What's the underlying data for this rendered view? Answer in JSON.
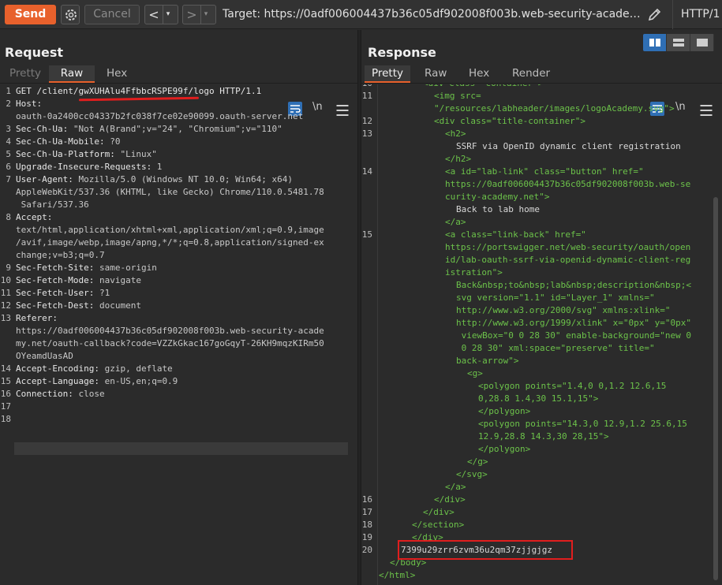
{
  "toolbar": {
    "send_label": "Send",
    "cancel_label": "Cancel",
    "back_arrow": "<",
    "forward_arrow": ">",
    "dropdown_arrow": "▾",
    "target_text": "Target: https://0adf006004437b36c05df902008f003b.web-security-academy.n...",
    "http_version": "HTTP/1",
    "send_color": "#e8612c"
  },
  "request": {
    "title": "Request",
    "tabs": [
      "Pretty",
      "Raw",
      "Hex"
    ],
    "active_tab": "Raw",
    "newline_toggle": "\\n",
    "lines": [
      {
        "n": "1",
        "k": "GET /client/gwXUHAlu4FfbbcRSPE99f/logo HTTP/1.1",
        "v": ""
      },
      {
        "n": "2",
        "k": "Host:",
        "v": ""
      },
      {
        "n": "",
        "k": "",
        "v": "oauth-0a2400cc04337b2fc038f7ce02e90099.oauth-server.net"
      },
      {
        "n": "3",
        "k": "Sec-Ch-Ua:",
        "v": " \"Not A(Brand\";v=\"24\", \"Chromium\";v=\"110\""
      },
      {
        "n": "4",
        "k": "Sec-Ch-Ua-Mobile:",
        "v": " ?0"
      },
      {
        "n": "5",
        "k": "Sec-Ch-Ua-Platform:",
        "v": " \"Linux\""
      },
      {
        "n": "6",
        "k": "Upgrade-Insecure-Requests:",
        "v": " 1"
      },
      {
        "n": "7",
        "k": "User-Agent:",
        "v": " Mozilla/5.0 (Windows NT 10.0; Win64; x64)"
      },
      {
        "n": "",
        "k": "",
        "v": "AppleWebKit/537.36 (KHTML, like Gecko) Chrome/110.0.5481.78"
      },
      {
        "n": "",
        "k": "",
        "v": " Safari/537.36"
      },
      {
        "n": "8",
        "k": "Accept:",
        "v": ""
      },
      {
        "n": "",
        "k": "",
        "v": "text/html,application/xhtml+xml,application/xml;q=0.9,image"
      },
      {
        "n": "",
        "k": "",
        "v": "/avif,image/webp,image/apng,*/*;q=0.8,application/signed-ex"
      },
      {
        "n": "",
        "k": "",
        "v": "change;v=b3;q=0.7"
      },
      {
        "n": "9",
        "k": "Sec-Fetch-Site:",
        "v": " same-origin"
      },
      {
        "n": "10",
        "k": "Sec-Fetch-Mode:",
        "v": " navigate"
      },
      {
        "n": "11",
        "k": "Sec-Fetch-User:",
        "v": " ?1"
      },
      {
        "n": "12",
        "k": "Sec-Fetch-Dest:",
        "v": " document"
      },
      {
        "n": "13",
        "k": "Referer:",
        "v": ""
      },
      {
        "n": "",
        "k": "",
        "v": "https://0adf006004437b36c05df902008f003b.web-security-acade"
      },
      {
        "n": "",
        "k": "",
        "v": "my.net/oauth-callback?code=VZZkGkac167goGqyT-26KH9mqzKIRm50"
      },
      {
        "n": "",
        "k": "",
        "v": "OYeamdUasAD"
      },
      {
        "n": "14",
        "k": "Accept-Encoding:",
        "v": " gzip, deflate"
      },
      {
        "n": "15",
        "k": "Accept-Language:",
        "v": " en-US,en;q=0.9"
      },
      {
        "n": "16",
        "k": "Connection:",
        "v": " close"
      },
      {
        "n": "17",
        "k": "",
        "v": ""
      },
      {
        "n": "18",
        "k": "",
        "v": ""
      }
    ]
  },
  "response": {
    "title": "Response",
    "tabs": [
      "Pretty",
      "Raw",
      "Hex",
      "Render"
    ],
    "active_tab": "Pretty",
    "newline_toggle": "\\n",
    "lines": [
      {
        "n": "10",
        "i": 56,
        "t": "<div class= container >"
      },
      {
        "n": "11",
        "i": 70,
        "t": "<img src="
      },
      {
        "n": "",
        "i": 70,
        "t": "\"/resources/labheader/images/logoAcademy.svg\">"
      },
      {
        "n": "12",
        "i": 70,
        "t": "<div class=\"title-container\">"
      },
      {
        "n": "13",
        "i": 84,
        "t": "<h2>"
      },
      {
        "n": "",
        "i": 98,
        "t": "SSRF via OpenID dynamic client registration"
      },
      {
        "n": "",
        "i": 84,
        "t": "</h2>"
      },
      {
        "n": "14",
        "i": 84,
        "t": "<a id=\"lab-link\" class=\"button\" href=\""
      },
      {
        "n": "",
        "i": 84,
        "t": "https://0adf006004437b36c05df902008f003b.web-se"
      },
      {
        "n": "",
        "i": 84,
        "t": "curity-academy.net\">"
      },
      {
        "n": "",
        "i": 98,
        "t": "Back to lab home"
      },
      {
        "n": "",
        "i": 84,
        "t": "</a>"
      },
      {
        "n": "15",
        "i": 84,
        "t": "<a class=\"link-back\" href=\""
      },
      {
        "n": "",
        "i": 84,
        "t": "https://portswigger.net/web-security/oauth/open"
      },
      {
        "n": "",
        "i": 84,
        "t": "id/lab-oauth-ssrf-via-openid-dynamic-client-reg"
      },
      {
        "n": "",
        "i": 84,
        "t": "istration\">"
      },
      {
        "n": "",
        "i": 98,
        "t": "Back&nbsp;to&nbsp;lab&nbsp;description&nbsp;<"
      },
      {
        "n": "",
        "i": 98,
        "t": "svg version=\"1.1\" id=\"Layer_1\" xmlns=\""
      },
      {
        "n": "",
        "i": 98,
        "t": "http://www.w3.org/2000/svg\" xmlns:xlink=\""
      },
      {
        "n": "",
        "i": 98,
        "t": "http://www.w3.org/1999/xlink\" x=\"0px\" y=\"0px\""
      },
      {
        "n": "",
        "i": 98,
        "t": " viewBox=\"0 0 28 30\" enable-background=\"new 0"
      },
      {
        "n": "",
        "i": 98,
        "t": " 0 28 30\" xml:space=\"preserve\" title=\""
      },
      {
        "n": "",
        "i": 98,
        "t": "back-arrow\">"
      },
      {
        "n": "",
        "i": 112,
        "t": "<g>"
      },
      {
        "n": "",
        "i": 126,
        "t": "<polygon points=\"1.4,0 0,1.2 12.6,15"
      },
      {
        "n": "",
        "i": 126,
        "t": "0,28.8 1.4,30 15.1,15\">"
      },
      {
        "n": "",
        "i": 126,
        "t": "</polygon>"
      },
      {
        "n": "",
        "i": 126,
        "t": "<polygon points=\"14.3,0 12.9,1.2 25.6,15"
      },
      {
        "n": "",
        "i": 126,
        "t": "12.9,28.8 14.3,30 28,15\">"
      },
      {
        "n": "",
        "i": 126,
        "t": "</polygon>"
      },
      {
        "n": "",
        "i": 112,
        "t": "</g>"
      },
      {
        "n": "",
        "i": 98,
        "t": "</svg>"
      },
      {
        "n": "",
        "i": 84,
        "t": "</a>"
      },
      {
        "n": "16",
        "i": 70,
        "t": "</div>"
      },
      {
        "n": "17",
        "i": 56,
        "t": "</div>"
      },
      {
        "n": "18",
        "i": 42,
        "t": "</section>"
      },
      {
        "n": "19",
        "i": 42,
        "t": "</div>"
      },
      {
        "n": "20",
        "i": 28,
        "t": "7399u29zrr6zvm36u2qm37zjjgjgz"
      },
      {
        "n": "",
        "i": 14,
        "t": "</body>"
      },
      {
        "n": "",
        "i": 0,
        "t": "</html>"
      }
    ]
  }
}
